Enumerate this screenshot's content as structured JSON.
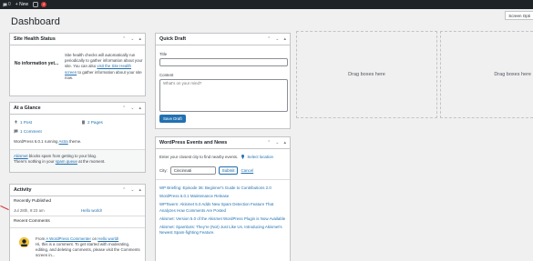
{
  "adminbar": {
    "wp_logo": "W",
    "comments_count": "0",
    "new_label": "+ New",
    "updates_count": "2"
  },
  "screen_options": "Screen Opti",
  "page_title": "Dashboard",
  "site_health": {
    "title": "Site Health Status",
    "status": "No information yet...",
    "text_1": "Site health checks will automatically run periodically to gather information about your site. You can also",
    "link_1": "visit the Site Health screen",
    "text_2": "to gather information about your site now."
  },
  "glance": {
    "title": "At a Glance",
    "posts": "1 Post",
    "pages": "2 Pages",
    "comments": "1 Comment",
    "running_pre": "WordPress 6.0.1 running",
    "theme_link": "Astra",
    "running_post": "theme.",
    "akismet_link": "Akismet",
    "akismet_text": "blocks spam from getting to your blog.",
    "spam_pre": "There's nothing in your",
    "spam_link": "spam queue",
    "spam_post": "at the moment."
  },
  "activity": {
    "title": "Activity",
    "recently_published": "Recently Published",
    "pub_date": "Jul 28th, 9:23 am",
    "pub_link": "Hello world!",
    "recent_comments": "Recent Comments",
    "comment_from": "From",
    "comment_author": "A WordPress Commenter",
    "comment_on": "on",
    "comment_post": "Hello world!",
    "comment_text": "Hi, this is a comment. To get started with moderating, editing, and deleting comments, please visit the Comments screen in..."
  },
  "quick_draft": {
    "title": "Quick Draft",
    "title_label": "Title",
    "content_label": "Content",
    "content_placeholder": "What's on your mind?",
    "save_label": "Save Draft"
  },
  "events": {
    "title": "WordPress Events and News",
    "intro": "Enter your closest city to find nearby events.",
    "select_location": "Select location",
    "city_label": "City:",
    "city_value": "Cincinnati",
    "submit_label": "Submit",
    "cancel_label": "Cancel",
    "news": [
      "WP Briefing: Episode 36: Beginner's Guide to Contributions 2.0",
      "WordPress 6.0.1 Maintenance Release",
      "WPTavern: Akismet 5.0 Adds New Spam Detection Feature That Analyzes How Comments Are Posted",
      "Akismet: Version 5.0 of the Akismet WordPress Plugin is Now Available",
      "Akismet: Spambots: They're (Not) Just Like Us. Introducing Akismet's Newest Spam-fighting Feature."
    ]
  },
  "drop_zone_1": "Drag boxes here",
  "drop_zone_2": "Drag boxes here",
  "colors": {
    "link": "#2271b1",
    "adminbar": "#1d2327",
    "badge": "#d63638"
  }
}
